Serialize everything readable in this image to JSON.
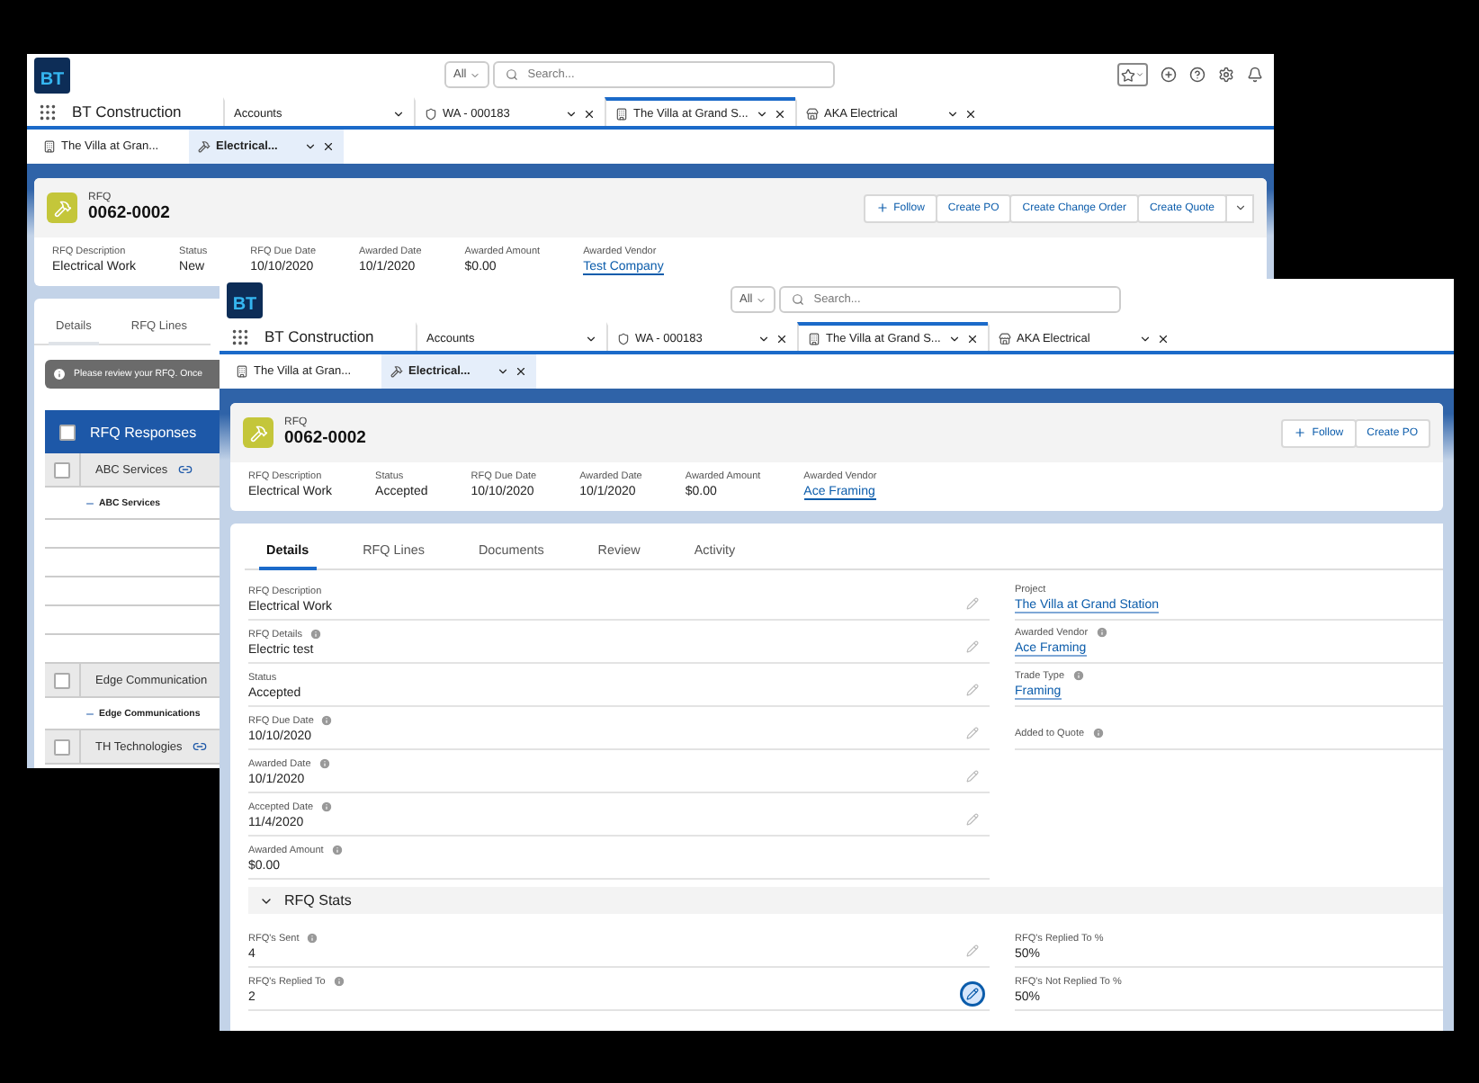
{
  "back_window": {
    "logo_text": "BT",
    "search": {
      "scope": "All",
      "placeholder": "Search..."
    },
    "app_name": "BT Construction",
    "nav_tabs": [
      {
        "label": "Accounts",
        "kind": "list",
        "selected": false
      },
      {
        "label": "WA - 000183",
        "kind": "work-order",
        "selected": false
      },
      {
        "label": "The Villa at Grand S...",
        "kind": "project",
        "selected": true
      },
      {
        "label": "AKA Electrical",
        "kind": "account",
        "selected": false
      }
    ],
    "sub_tabs": [
      {
        "label": "The Villa at Gran...",
        "kind": "project",
        "selected": false
      },
      {
        "label": "Electrical...",
        "kind": "rfq",
        "selected": true
      }
    ],
    "record": {
      "type": "RFQ",
      "number": "0062-0002"
    },
    "actions": [
      {
        "label": "Follow",
        "kind": "follow"
      },
      {
        "label": "Create PO",
        "kind": "plain"
      },
      {
        "label": "Create Change Order",
        "kind": "plain"
      },
      {
        "label": "Create Quote",
        "kind": "plain"
      }
    ],
    "highlights": [
      {
        "label": "RFQ Description",
        "value": "Electrical Work",
        "kind": "text"
      },
      {
        "label": "Status",
        "value": "New",
        "kind": "text"
      },
      {
        "label": "RFQ Due Date",
        "value": "10/10/2020",
        "kind": "text"
      },
      {
        "label": "Awarded Date",
        "value": "10/1/2020",
        "kind": "text"
      },
      {
        "label": "Awarded Amount",
        "value": "$0.00",
        "kind": "text"
      },
      {
        "label": "Awarded Vendor",
        "value": "Test Company",
        "kind": "link"
      }
    ],
    "detail_tabs": [
      {
        "label": "Details",
        "selected": true
      },
      {
        "label": "RFQ Lines",
        "selected": false
      }
    ],
    "notice": "Please review your RFQ. Once",
    "responses": {
      "title": "RFQ Responses",
      "checked": false,
      "rows": [
        {
          "kind": "vendor",
          "label": "ABC Services",
          "linked": true,
          "checked": false
        },
        {
          "kind": "contact",
          "label": "ABC Services"
        },
        {
          "kind": "blank"
        },
        {
          "kind": "blank"
        },
        {
          "kind": "blank"
        },
        {
          "kind": "blank"
        },
        {
          "kind": "blank"
        },
        {
          "kind": "vendor",
          "label": "Edge Communication",
          "linked": false,
          "checked": false
        },
        {
          "kind": "contact",
          "label": "Edge Communications"
        },
        {
          "kind": "vendor",
          "label": "TH Technologies",
          "linked": true,
          "checked": false
        }
      ]
    }
  },
  "front_window": {
    "logo_text": "BT",
    "search": {
      "scope": "All",
      "placeholder": "Search..."
    },
    "app_name": "BT Construction",
    "nav_tabs": [
      {
        "label": "Accounts",
        "kind": "list",
        "selected": false
      },
      {
        "label": "WA - 000183",
        "kind": "work-order",
        "selected": false
      },
      {
        "label": "The Villa at Grand S...",
        "kind": "project",
        "selected": true
      },
      {
        "label": "AKA Electrical",
        "kind": "account",
        "selected": false
      }
    ],
    "sub_tabs": [
      {
        "label": "The Villa at Gran...",
        "kind": "project",
        "selected": false
      },
      {
        "label": "Electrical...",
        "kind": "rfq",
        "selected": true
      }
    ],
    "record": {
      "type": "RFQ",
      "number": "0062-0002"
    },
    "actions": [
      {
        "label": "Follow",
        "kind": "follow"
      },
      {
        "label": "Create PO",
        "kind": "plain"
      }
    ],
    "highlights": [
      {
        "label": "RFQ Description",
        "value": "Electrical Work",
        "kind": "text"
      },
      {
        "label": "Status",
        "value": "Accepted",
        "kind": "text"
      },
      {
        "label": "RFQ Due Date",
        "value": "10/10/2020",
        "kind": "text"
      },
      {
        "label": "Awarded Date",
        "value": "10/1/2020",
        "kind": "text"
      },
      {
        "label": "Awarded Amount",
        "value": "$0.00",
        "kind": "text"
      },
      {
        "label": "Awarded Vendor",
        "value": "Ace Framing",
        "kind": "link"
      }
    ],
    "detail_tabs": [
      {
        "label": "Details",
        "selected": true
      },
      {
        "label": "RFQ Lines",
        "selected": false
      },
      {
        "label": "Documents",
        "selected": false
      },
      {
        "label": "Review",
        "selected": false
      },
      {
        "label": "Activity",
        "selected": false
      }
    ],
    "fields": {
      "left": [
        {
          "label": "RFQ Description",
          "value": "Electrical Work",
          "info": false,
          "kind": "text",
          "editable": true,
          "focused": false
        },
        {
          "label": "RFQ Details",
          "value": "Electric test",
          "info": true,
          "kind": "text",
          "editable": true,
          "focused": false
        },
        {
          "label": "Status",
          "value": "Accepted",
          "info": false,
          "kind": "text",
          "editable": true,
          "focused": false
        },
        {
          "label": "RFQ Due Date",
          "value": "10/10/2020",
          "info": true,
          "kind": "text",
          "editable": true,
          "focused": false
        },
        {
          "label": "Awarded Date",
          "value": "10/1/2020",
          "info": true,
          "kind": "text",
          "editable": true,
          "focused": false
        },
        {
          "label": "Accepted Date",
          "value": "11/4/2020",
          "info": true,
          "kind": "text",
          "editable": true,
          "focused": false
        },
        {
          "label": "Awarded Amount",
          "value": "$0.00",
          "info": true,
          "kind": "text",
          "editable": false
        }
      ],
      "right": [
        {
          "label": "Project",
          "value": "The Villa at Grand Station",
          "info": false,
          "kind": "link",
          "editable": false
        },
        {
          "label": "Awarded Vendor",
          "value": "Ace Framing",
          "info": true,
          "kind": "link",
          "editable": false
        },
        {
          "label": "Trade Type",
          "value": "Framing",
          "info": true,
          "kind": "link",
          "editable": false
        },
        {
          "label": "Added to Quote",
          "info": true,
          "editable": false
        }
      ]
    },
    "sections": [
      {
        "title": "RFQ Stats",
        "expanded": true,
        "left": [
          {
            "label": "RFQ's Sent",
            "value": "4",
            "info": true,
            "kind": "text",
            "editable": true,
            "focused": false
          },
          {
            "label": "RFQ's Replied To",
            "value": "2",
            "info": true,
            "kind": "text",
            "editable": true,
            "focused": true
          }
        ],
        "right": [
          {
            "label": "RFQ's Replied To %",
            "value": "50%",
            "info": false,
            "kind": "text",
            "editable": false
          },
          {
            "label": "RFQ's Not Replied To %",
            "value": "50%",
            "info": false,
            "kind": "text",
            "editable": false
          }
        ]
      }
    ]
  }
}
